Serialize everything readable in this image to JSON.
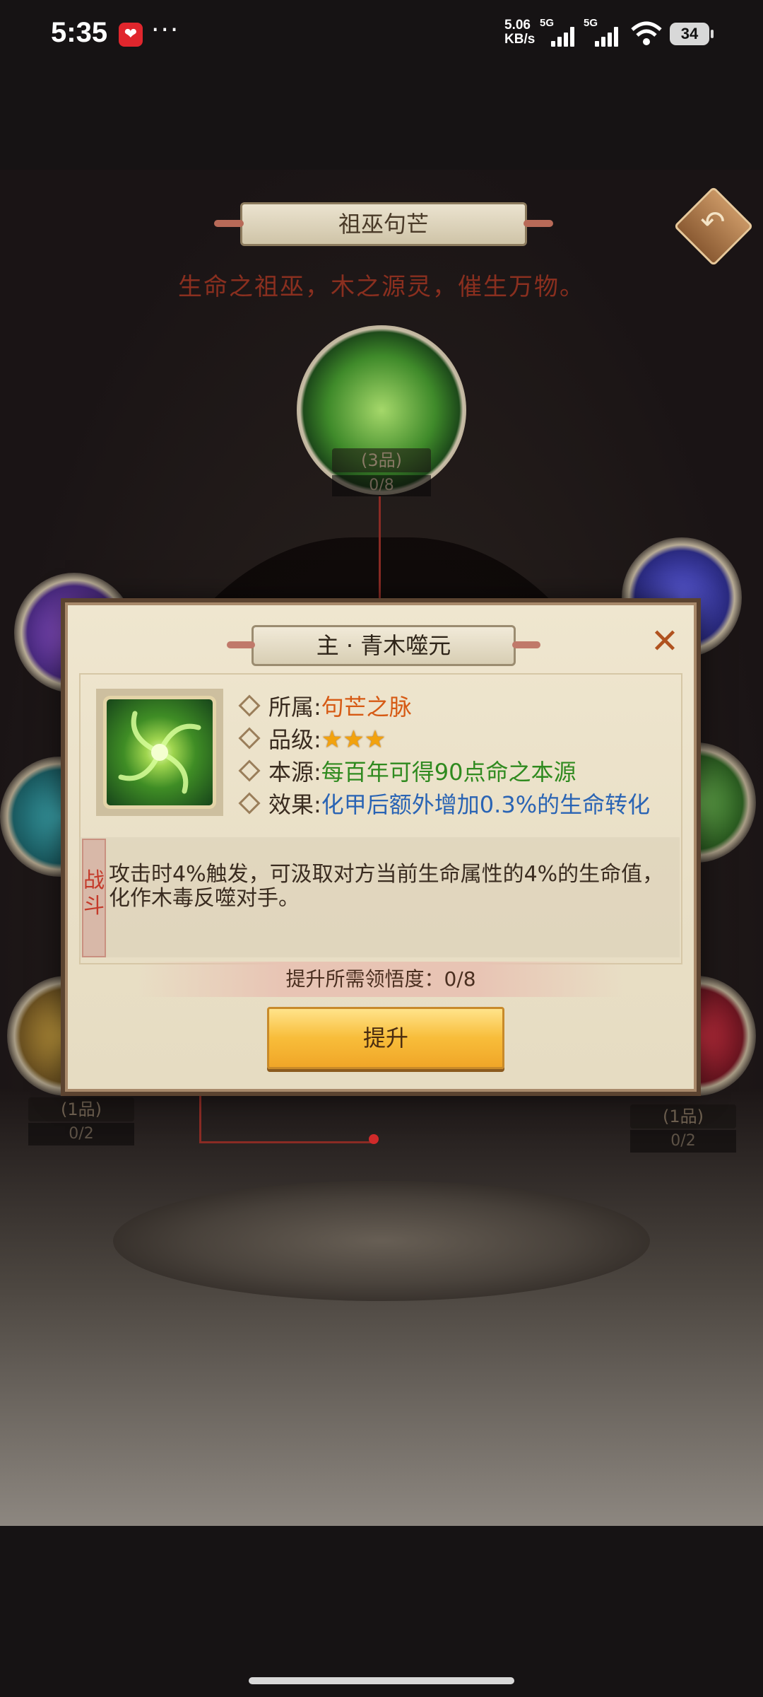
{
  "status_bar": {
    "time": "5:35",
    "more": "···",
    "net_speed_value": "5.06",
    "net_speed_unit": "KB/s",
    "sim1": "5G",
    "sim2": "5G",
    "battery": "34",
    "icons": [
      "app-notification-icon",
      "signal-icon",
      "wifi-icon",
      "battery-icon"
    ]
  },
  "screen": {
    "title": "祖巫句芒",
    "subtitle": "生命之祖巫，木之源灵，催生万物。",
    "main_node": {
      "grade": "(3品)",
      "progress": "0/8"
    },
    "left_node": {
      "grade": "(1品)",
      "progress": "0/2"
    },
    "right_node": {
      "grade": "(1品)",
      "progress": "0/2"
    }
  },
  "modal": {
    "title": "主 · 青木噬元",
    "close": "✕",
    "attributes": [
      {
        "label": "所属",
        "value": "句芒之脉"
      },
      {
        "label": "品级",
        "stars": "★★★",
        "star_count": 3
      },
      {
        "label": "本源",
        "value": "每百年可得90点命之本源"
      },
      {
        "label": "效果",
        "value": "化甲后额外增加0.3%的生命转化"
      }
    ],
    "tag": "战斗",
    "description": "攻击时4%触发，可汲取对方当前生命属性的4%的生命值，化作木毒反噬对手。",
    "requirement": "提升所需领悟度：0/8",
    "upgrade_button": "提升"
  },
  "colors": {
    "accent_orange": "#d65a14",
    "accent_green": "#2f8a1f",
    "accent_blue": "#2a64b4",
    "star": "#f2a20e",
    "button_gold": "#f8bd3a"
  }
}
